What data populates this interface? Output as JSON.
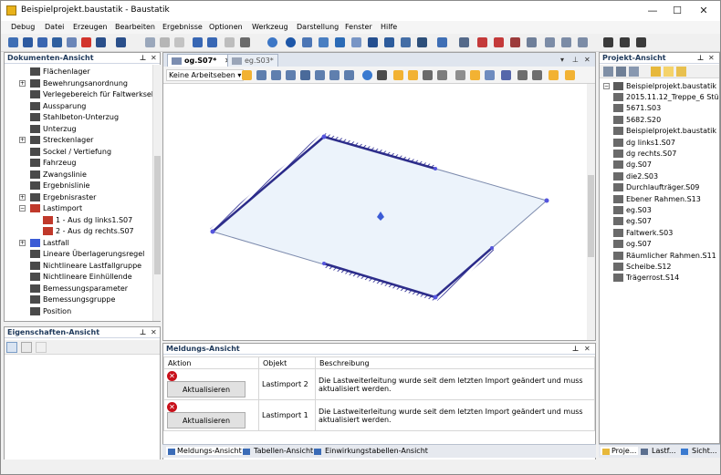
{
  "window": {
    "title": "Beispielprojekt.baustatik - Baustatik",
    "minimize": "—",
    "maximize": "☐",
    "close": "✕"
  },
  "menu": [
    "Debug",
    "Datei",
    "Erzeugen",
    "Bearbeiten",
    "Ergebnisse",
    "Optionen",
    "Werkzeug",
    "Darstellung",
    "Fenster",
    "Hilfe"
  ],
  "doc_panel": {
    "title": "Dokumenten-Ansicht",
    "items": [
      {
        "label": "Flächenlager",
        "indent": 1,
        "icon": "surface-support-icon"
      },
      {
        "label": "Bewehrungsanordnung",
        "indent": 1,
        "icon": "reinforcement-icon",
        "expand": "+"
      },
      {
        "label": "Verlegebereich für Faltwerkselem",
        "indent": 1,
        "icon": "area-icon"
      },
      {
        "label": "Aussparung",
        "indent": 1,
        "icon": "opening-icon"
      },
      {
        "label": "Stahlbeton-Unterzug",
        "indent": 1,
        "icon": "beam-icon"
      },
      {
        "label": "Unterzug",
        "indent": 1,
        "icon": "joist-icon"
      },
      {
        "label": "Streckenlager",
        "indent": 1,
        "icon": "line-support-icon",
        "expand": "+"
      },
      {
        "label": "Sockel / Vertiefung",
        "indent": 1,
        "icon": "pedestal-icon"
      },
      {
        "label": "Fahrzeug",
        "indent": 1,
        "icon": "vehicle-icon"
      },
      {
        "label": "Zwangslinie",
        "indent": 1,
        "icon": "constraint-line-icon"
      },
      {
        "label": "Ergebnislinie",
        "indent": 1,
        "icon": "result-line-icon"
      },
      {
        "label": "Ergebnisraster",
        "indent": 1,
        "icon": "result-grid-icon",
        "expand": "+"
      },
      {
        "label": "Lastimport",
        "indent": 1,
        "icon": "load-import-icon",
        "expand": "−"
      },
      {
        "label": "1 - Aus dg links1.S07",
        "indent": 2,
        "icon": "import-item-icon"
      },
      {
        "label": "2 - Aus dg rechts.S07",
        "indent": 2,
        "icon": "import-item-icon"
      },
      {
        "label": "Lastfall",
        "indent": 1,
        "icon": "load-case-icon",
        "expand": "+"
      },
      {
        "label": "Lineare Überlagerungsregel",
        "indent": 1,
        "icon": "linear-rule-icon"
      },
      {
        "label": "Nichtlineare Lastfallgruppe",
        "indent": 1,
        "icon": "nonlinear-group-icon"
      },
      {
        "label": "Nichtlineare Einhüllende",
        "indent": 1,
        "icon": "envelope-icon"
      },
      {
        "label": "Bemessungsparameter",
        "indent": 1,
        "icon": "design-param-icon"
      },
      {
        "label": "Bemessungsgruppe",
        "indent": 1,
        "icon": "design-group-icon"
      },
      {
        "label": "Position",
        "indent": 1,
        "icon": "position-icon"
      }
    ]
  },
  "prop_panel": {
    "title": "Eigenschaften-Ansicht"
  },
  "editor": {
    "tabs": [
      {
        "label": "og.S07*",
        "active": true
      },
      {
        "label": "eg.S03*",
        "active": false
      }
    ],
    "workspace_select": "Keine Arbeitseben ▾"
  },
  "messages": {
    "title": "Meldungs-Ansicht",
    "columns": [
      "Aktion",
      "Objekt",
      "Beschreibung"
    ],
    "rows": [
      {
        "action": "Aktualisieren",
        "object": "Lastimport 2",
        "description": "Die Lastweiterleitung wurde seit dem letzten Import geändert und muss aktualisiert werden."
      },
      {
        "action": "Aktualisieren",
        "object": "Lastimport 1",
        "description": "Die Lastweiterleitung wurde seit dem letzten Import geändert und muss aktualisiert werden."
      }
    ]
  },
  "bottom_tabs": [
    "Meldungs-Ansicht",
    "Tabellen-Ansicht",
    "Einwirkungstabellen-Ansicht"
  ],
  "proj_panel": {
    "title": "Projekt-Ansicht",
    "root": "Beispielprojekt.baustatik",
    "items": [
      "2015.11.12_Treppe_6 Stü",
      "5671.S03",
      "5682.S20",
      "Beispielprojekt.baustatik",
      "dg links1.S07",
      "dg rechts.S07",
      "dg.S07",
      "die2.S03",
      "Durchlaufträger.S09",
      "Ebener Rahmen.S13",
      "eg.S03",
      "eg.S07",
      "Faltwerk.S03",
      "og.S07",
      "Räumlicher Rahmen.S11",
      "Scheibe.S12",
      "Trägerrost.S14"
    ],
    "bottom_tabs": [
      "Proje...",
      "Lastf...",
      "Sicht..."
    ]
  }
}
